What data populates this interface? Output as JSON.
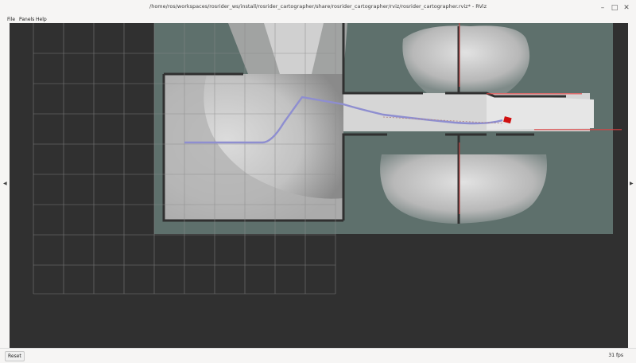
{
  "window": {
    "title": "/home/ros/workspaces/rosrider_ws/install/rosrider_cartographer/share/rosrider_cartographer/rviz/rosrider_cartographer.rviz* - RViz",
    "controls": [
      "minimize-icon",
      "maximize-icon",
      "close-icon"
    ]
  },
  "menu": [
    {
      "label": "File"
    },
    {
      "label": "Panels"
    },
    {
      "label": "Help"
    }
  ],
  "sidebar": {
    "left_arrow": "expand-left-panel-icon",
    "right_arrow": "expand-right-panel-icon"
  },
  "status": {
    "reset_label": "Reset",
    "fps": "31 fps"
  },
  "colors": {
    "viewport_bg": "#303030",
    "unknown_space": "#5e706c",
    "free_space": "#cfcfcf",
    "walls": "#303030",
    "grid": "#8a8a8a",
    "path": "#8e8ed0",
    "robot": "#d01010",
    "laser": "#e04040"
  }
}
